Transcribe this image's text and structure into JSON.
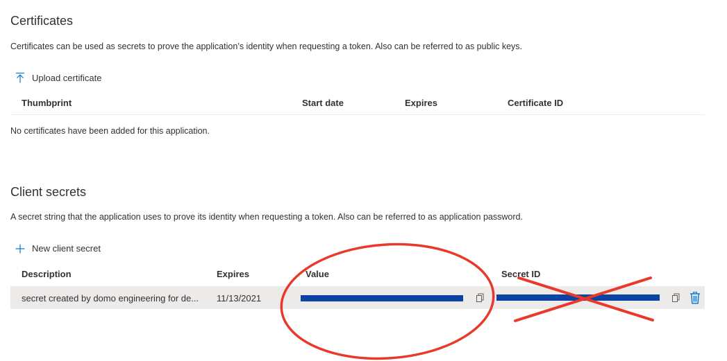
{
  "certificates": {
    "title": "Certificates",
    "description": "Certificates can be used as secrets to prove the application’s identity when requesting a token. Also can be referred to as public keys.",
    "upload_label": "Upload certificate",
    "columns": {
      "thumbprint": "Thumbprint",
      "start_date": "Start date",
      "expires": "Expires",
      "certificate_id": "Certificate ID"
    },
    "empty_message": "No certificates have been added for this application."
  },
  "client_secrets": {
    "title": "Client secrets",
    "description": "A secret string that the application uses to prove its identity when requesting a token. Also can be referred to as application password.",
    "new_label": "New client secret",
    "columns": {
      "description": "Description",
      "expires": "Expires",
      "value": "Value",
      "secret_id": "Secret ID"
    },
    "rows": [
      {
        "description": "secret created by domo engineering for de...",
        "expires": "11/13/2021"
      }
    ]
  },
  "colors": {
    "accent": "#0078d4",
    "redaction": "#0b43a4",
    "annotation": "#e8392b",
    "row_bg": "#edebe9"
  },
  "icons": {
    "upload": "upload-icon",
    "add": "plus-icon",
    "copy": "copy-icon",
    "delete": "trash-icon"
  }
}
